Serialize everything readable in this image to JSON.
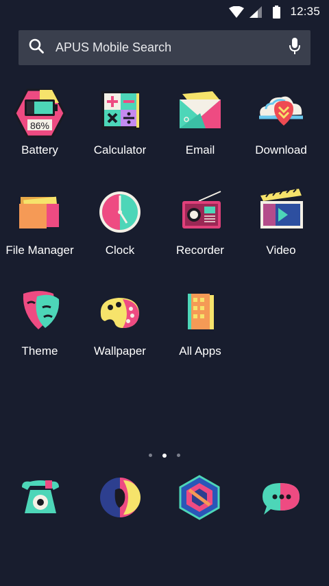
{
  "status_bar": {
    "time": "12:35",
    "icons": [
      "wifi-icon",
      "signal-icon",
      "battery-icon"
    ]
  },
  "search": {
    "placeholder": "APUS Mobile Search",
    "icons": [
      "search-icon",
      "microphone-icon"
    ]
  },
  "apps": [
    {
      "label": "Battery",
      "icon": "battery-hexagon-icon",
      "badge": "86%"
    },
    {
      "label": "Calculator",
      "icon": "calculator-icon"
    },
    {
      "label": "Email",
      "icon": "email-envelope-icon"
    },
    {
      "label": "Download",
      "icon": "cloud-download-icon"
    },
    {
      "label": "File Manager",
      "icon": "folder-icon"
    },
    {
      "label": "Clock",
      "icon": "clock-icon"
    },
    {
      "label": "Recorder",
      "icon": "radio-recorder-icon"
    },
    {
      "label": "Video",
      "icon": "clapperboard-icon"
    },
    {
      "label": "Theme",
      "icon": "theater-mask-icon"
    },
    {
      "label": "Wallpaper",
      "icon": "paint-palette-icon"
    },
    {
      "label": "All Apps",
      "icon": "book-grid-icon"
    }
  ],
  "pages": {
    "count": 3,
    "active_index": 1
  },
  "dock": [
    {
      "icon": "phone-icon"
    },
    {
      "icon": "contacts-icon"
    },
    {
      "icon": "browser-hexagon-icon"
    },
    {
      "icon": "messaging-bubble-icon"
    }
  ],
  "colors": {
    "background": "#181d2e",
    "search_background": "#3a3f4d",
    "pink": "#ee4b82",
    "teal": "#4dd6b8",
    "yellow": "#f6e36b",
    "orange": "#f59a56"
  }
}
